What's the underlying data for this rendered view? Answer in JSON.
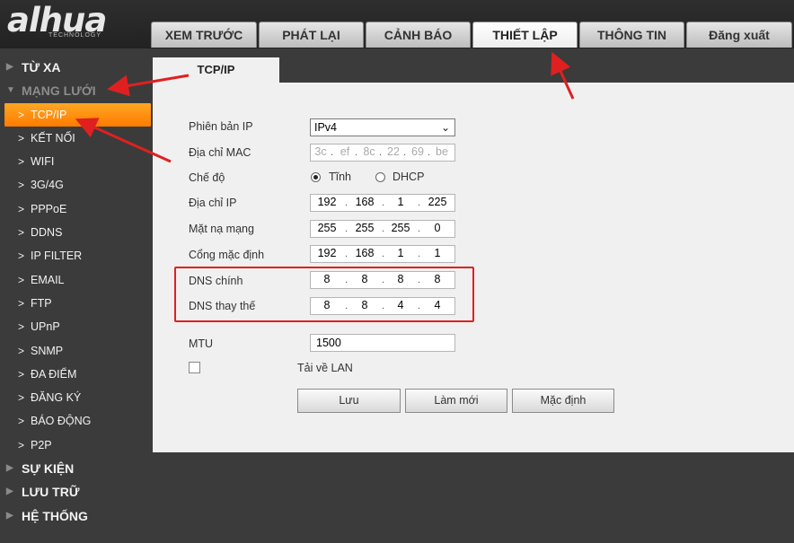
{
  "logo": {
    "text": "alhua",
    "subtext": "TECHNOLOGY"
  },
  "tabs": [
    "XEM TRƯỚC",
    "PHÁT LẠI",
    "CẢNH BÁO",
    "THIẾT LẬP",
    "THÔNG TIN",
    "Đăng xuất"
  ],
  "active_tab": "THIẾT LẬP",
  "sidebar": {
    "top1": "TỪ XA",
    "top2": "MẠNG LƯỚI",
    "sub": [
      "TCP/IP",
      "KẾT NỐI",
      "WIFI",
      "3G/4G",
      "PPPoE",
      "DDNS",
      "IP FILTER",
      "EMAIL",
      "FTP",
      "UPnP",
      "SNMP",
      "ĐA ĐIỂM",
      "ĐĂNG KÝ",
      "BÁO ĐỘNG",
      "P2P"
    ],
    "bottom": [
      "SỰ KIỆN",
      "LƯU TRỮ",
      "HỆ THỐNG"
    ]
  },
  "content_tab": "TCP/IP",
  "form": {
    "ip_version_label": "Phiên bản IP",
    "ip_version_value": "IPv4",
    "mac_label": "Địa chỉ MAC",
    "mac": [
      "3c",
      "ef",
      "8c",
      "22",
      "69",
      "be"
    ],
    "mode_label": "Chế độ",
    "mode_static": "Tĩnh",
    "mode_dhcp": "DHCP",
    "ip_label": "Địa chỉ IP",
    "ip": [
      "192",
      "168",
      "1",
      "225"
    ],
    "mask_label": "Mặt nạ mạng",
    "mask": [
      "255",
      "255",
      "255",
      "0"
    ],
    "gateway_label": "Cổng mặc định",
    "gateway": [
      "192",
      "168",
      "1",
      "1"
    ],
    "dns1_label": "DNS chính",
    "dns1": [
      "8",
      "8",
      "8",
      "8"
    ],
    "dns2_label": "DNS thay thế",
    "dns2": [
      "8",
      "8",
      "4",
      "4"
    ],
    "mtu_label": "MTU",
    "mtu": "1500",
    "lan_label": "Tải về LAN"
  },
  "buttons": {
    "save": "Lưu",
    "refresh": "Làm mới",
    "default": "Mặc định"
  },
  "colors": {
    "accent": "#ff8c00",
    "annotation": "#e02020"
  }
}
